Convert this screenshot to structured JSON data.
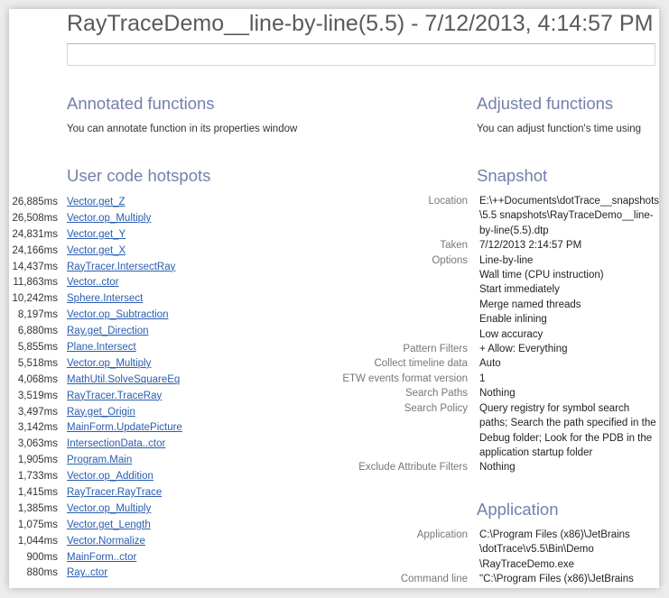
{
  "title": "RayTraceDemo__line-by-line(5.5) - 7/12/2013, 4:14:57 PM",
  "filter_value": "",
  "annotated": {
    "heading": "Annotated functions",
    "text": "You can annotate function in its properties window"
  },
  "adjusted": {
    "heading": "Adjusted functions",
    "text": "You can adjust function's time using"
  },
  "hotspots": {
    "heading": "User code hotspots",
    "items": [
      {
        "time": "26,885ms",
        "name": "Vector.get_Z"
      },
      {
        "time": "26,508ms",
        "name": "Vector.op_Multiply"
      },
      {
        "time": "24,831ms",
        "name": "Vector.get_Y"
      },
      {
        "time": "24,166ms",
        "name": "Vector.get_X"
      },
      {
        "time": "14,437ms",
        "name": "RayTracer.IntersectRay"
      },
      {
        "time": "11,863ms",
        "name": "Vector..ctor"
      },
      {
        "time": "10,242ms",
        "name": "Sphere.Intersect"
      },
      {
        "time": "8,197ms",
        "name": "Vector.op_Subtraction"
      },
      {
        "time": "6,880ms",
        "name": "Ray.get_Direction"
      },
      {
        "time": "5,855ms",
        "name": "Plane.Intersect"
      },
      {
        "time": "5,518ms",
        "name": "Vector.op_Multiply"
      },
      {
        "time": "4,068ms",
        "name": "MathUtil.SolveSquareEq"
      },
      {
        "time": "3,519ms",
        "name": "RayTracer.TraceRay"
      },
      {
        "time": "3,497ms",
        "name": "Ray.get_Origin"
      },
      {
        "time": "3,142ms",
        "name": "MainForm.UpdatePicture"
      },
      {
        "time": "3,063ms",
        "name": "IntersectionData..ctor"
      },
      {
        "time": "1,905ms",
        "name": "Program.Main"
      },
      {
        "time": "1,733ms",
        "name": "Vector.op_Addition"
      },
      {
        "time": "1,415ms",
        "name": "RayTracer.RayTrace"
      },
      {
        "time": "1,385ms",
        "name": "Vector.op_Multiply"
      },
      {
        "time": "1,075ms",
        "name": "Vector.get_Length"
      },
      {
        "time": "1,044ms",
        "name": "Vector.Normalize"
      },
      {
        "time": "900ms",
        "name": "MainForm..ctor"
      },
      {
        "time": "880ms",
        "name": "Ray..ctor"
      }
    ]
  },
  "snapshot": {
    "heading": "Snapshot",
    "rows": [
      {
        "key": "Location",
        "values": [
          "E:\\++Documents\\dotTrace__snapshots",
          "\\5.5 snapshots\\RayTraceDemo__line-",
          "by-line(5.5).dtp"
        ]
      },
      {
        "key": "Taken",
        "values": [
          "7/12/2013 2:14:57 PM"
        ]
      },
      {
        "key": "Options",
        "values": [
          "Line-by-line",
          "Wall time (CPU instruction)",
          "Start immediately",
          "Merge named threads",
          "Enable inlining",
          "Low accuracy"
        ]
      },
      {
        "key": "Pattern Filters",
        "values": [
          "+ Allow: Everything"
        ]
      },
      {
        "key": "Collect timeline data",
        "values": [
          "Auto"
        ]
      },
      {
        "key": "ETW events format version",
        "values": [
          "1"
        ]
      },
      {
        "key": "Search Paths",
        "values": [
          "Nothing"
        ]
      },
      {
        "key": "Search Policy",
        "values": [
          "Query registry for symbol search",
          "paths; Search the path specified in the",
          "Debug folder; Look for the PDB in the",
          "application startup folder"
        ]
      },
      {
        "key": "Exclude Attribute Filters",
        "values": [
          "Nothing"
        ]
      }
    ]
  },
  "application": {
    "heading": "Application",
    "rows": [
      {
        "key": "Application",
        "values": [
          "C:\\Program Files (x86)\\JetBrains",
          "\\dotTrace\\v5.5\\Bin\\Demo",
          "\\RayTraceDemo.exe"
        ]
      },
      {
        "key": "Command line",
        "values": [
          "\"C:\\Program Files (x86)\\JetBrains"
        ]
      }
    ]
  }
}
